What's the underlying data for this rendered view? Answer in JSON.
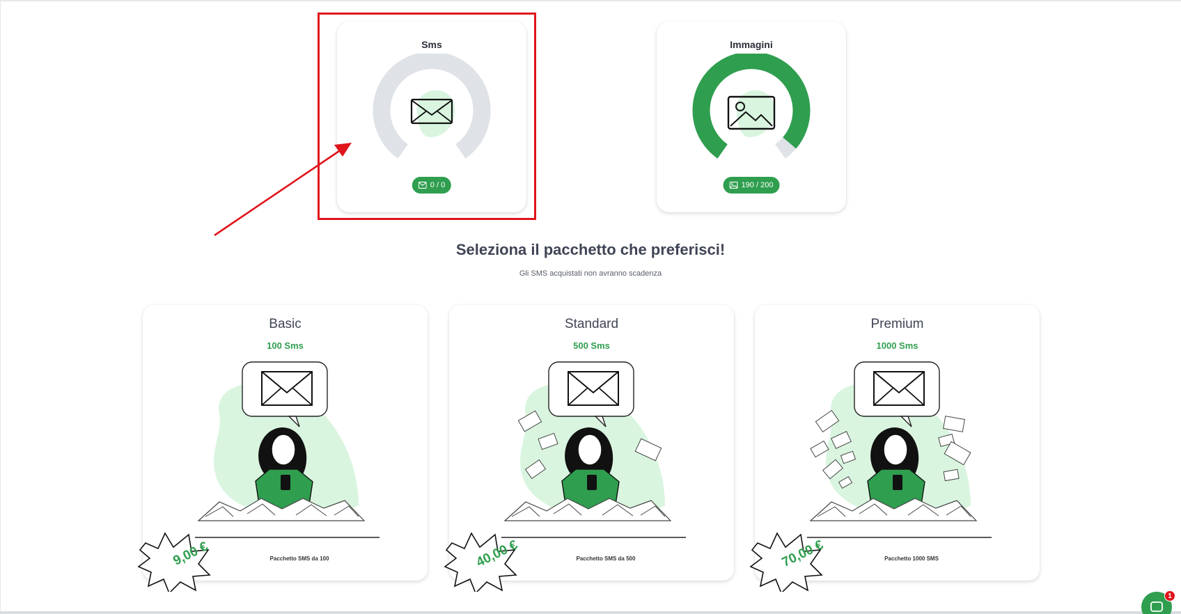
{
  "usage": [
    {
      "title": "Sms",
      "icon": "envelope-icon",
      "pill_icon": "envelope-icon",
      "pill_text": "0 / 0",
      "used_fraction": 0,
      "ring_color": "#dfe2e6",
      "fill_color": "#2f9e4f"
    },
    {
      "title": "Immagini",
      "icon": "image-icon",
      "pill_icon": "image-icon",
      "pill_text": "190 / 200",
      "used_fraction": 0.95,
      "ring_color": "#dfe2e6",
      "fill_color": "#2f9e4f"
    }
  ],
  "heading": "Seleziona il pacchetto che preferisci!",
  "subheading": "Gli SMS acquistati non avranno scadenza",
  "packages": [
    {
      "name": "Basic",
      "quantity": "100 Sms",
      "price": "9,00 €",
      "description": "Pacchetto SMS da 100"
    },
    {
      "name": "Standard",
      "quantity": "500 Sms",
      "price": "40,00 €",
      "description": "Pacchetto SMS da 500"
    },
    {
      "name": "Premium",
      "quantity": "1000 Sms",
      "price": "70,00 €",
      "description": "Pacchetto 1000 SMS"
    }
  ],
  "chat": {
    "badge_count": "1"
  },
  "colors": {
    "accent": "#2f9e4f",
    "annotation": "#e0141b",
    "blob": "#d9f5df",
    "text": "#3f4555"
  }
}
